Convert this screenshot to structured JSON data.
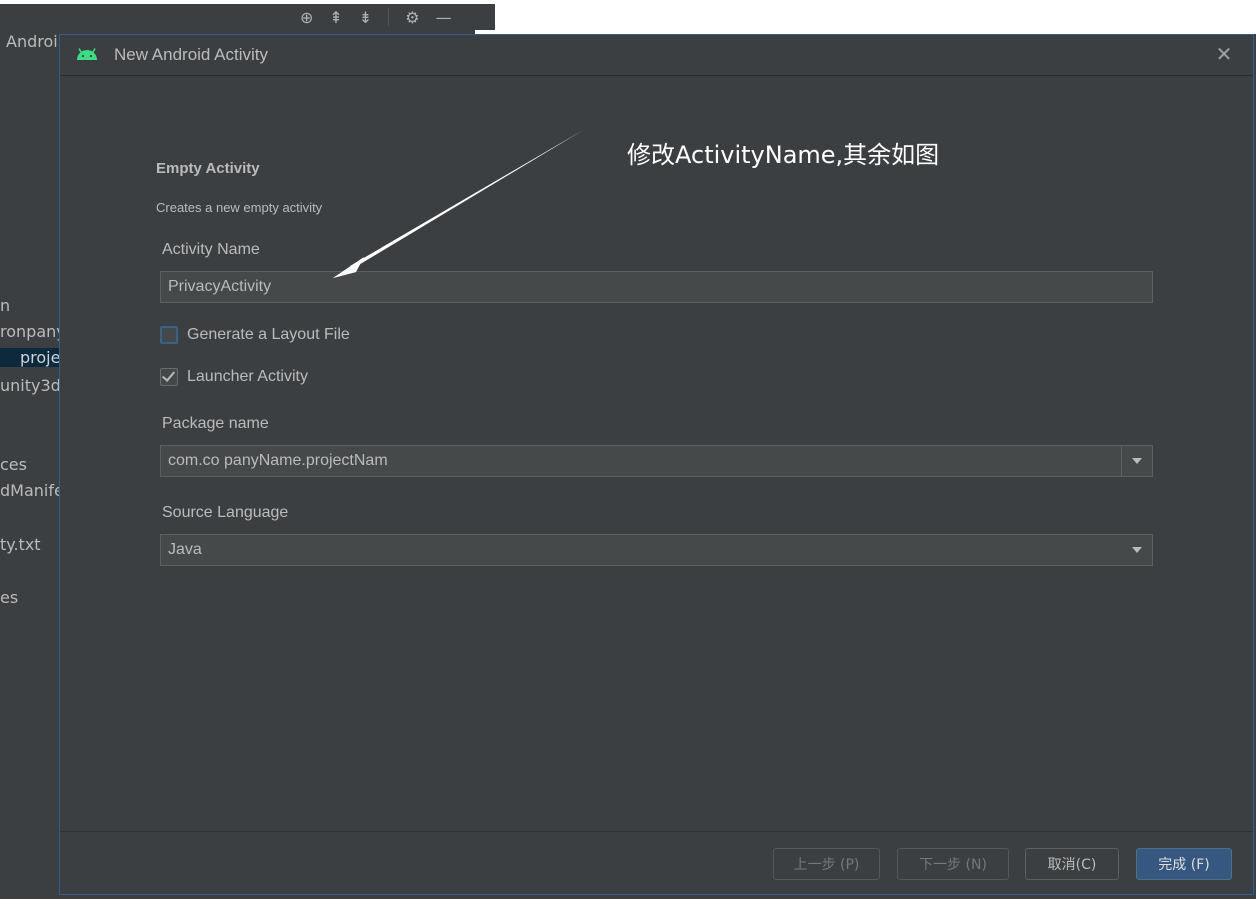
{
  "ide": {
    "tree_items": [
      {
        "label": "Androi",
        "top": 0
      },
      {
        "label": "n"
      },
      {
        "label": "ronpany"
      },
      {
        "label": "proje"
      },
      {
        "label": "unity3d"
      },
      {
        "label": "ces"
      },
      {
        "label": "dManife"
      },
      {
        "label": "ty.txt"
      },
      {
        "label": "es"
      }
    ]
  },
  "dialog": {
    "title": "New Android Activity",
    "close_icon": "close-icon",
    "section_title": "Empty Activity",
    "section_desc": "Creates a new empty activity",
    "activity_name": {
      "label": "Activity Name",
      "value": "PrivacyActivity"
    },
    "generate_layout": {
      "label": "Generate a Layout File",
      "checked": false
    },
    "launcher_activity": {
      "label": "Launcher Activity",
      "checked": true
    },
    "package_name": {
      "label": "Package name",
      "value": "com.co  panyName.projectNam"
    },
    "source_language": {
      "label": "Source Language",
      "value": "Java"
    },
    "annotation": "修改ActivityName,其余如图",
    "buttons": {
      "previous": "上一步 (P)",
      "next": "下一步 (N)",
      "cancel": "取消(C)",
      "finish": "完成 (F)"
    }
  },
  "colors": {
    "dialog_bg": "#3c3f41",
    "input_bg": "#45494a",
    "primary_button": "#365880",
    "android_green": "#3ddc84"
  }
}
